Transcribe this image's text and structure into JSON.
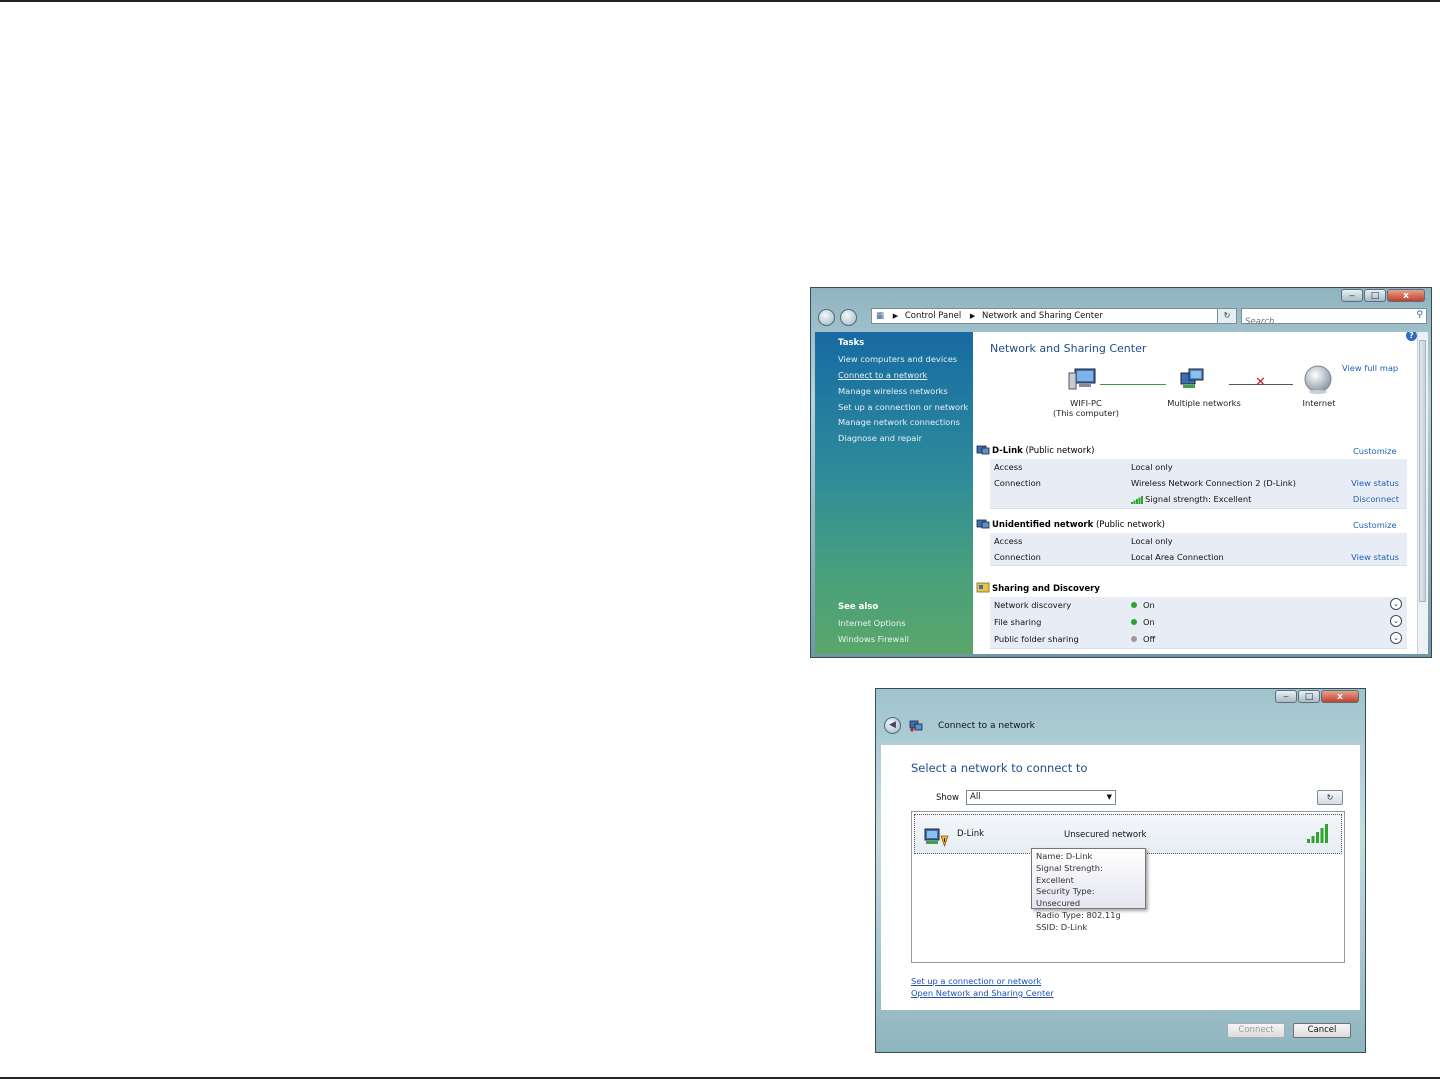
{
  "colors": {
    "link": "#1e5fb8",
    "title": "#1f4d8c",
    "status_on": "#2ea52e",
    "status_off": "#9a9a9a",
    "error_x": "#d42020",
    "signal": "#2ea52e"
  },
  "network_center": {
    "window_buttons": {
      "minimize": "‒",
      "maximize": "□",
      "close": "x"
    },
    "address": {
      "segments": [
        "Control Panel",
        "Network and Sharing Center"
      ]
    },
    "search": {
      "placeholder": "Search"
    },
    "sidebar": {
      "tasks_heading": "Tasks",
      "tasks": [
        "View computers and devices",
        "Connect to a network",
        "Manage wireless networks",
        "Set up a connection or network",
        "Manage network connections",
        "Diagnose and repair"
      ],
      "see_also_heading": "See also",
      "see_also": [
        "Internet Options",
        "Windows Firewall"
      ]
    },
    "title": "Network and Sharing Center",
    "view_full_map": "View full map",
    "map": {
      "computer_name": "WIFI-PC",
      "computer_sub": "(This computer)",
      "middle": "Multiple networks",
      "internet": "Internet",
      "icons": [
        "computer-icon",
        "network-icon",
        "globe-icon"
      ]
    },
    "networks": [
      {
        "name": "D-Link",
        "type": "(Public network)",
        "customize": "Customize",
        "rows": [
          {
            "key": "Access",
            "value": "Local only",
            "action": ""
          },
          {
            "key": "Connection",
            "value": "Wireless Network Connection 2 (D-Link)",
            "action": "View status"
          },
          {
            "key": "",
            "value": "Signal strength:  Excellent",
            "action": "Disconnect"
          }
        ]
      },
      {
        "name": "Unidentified network",
        "type": "(Public network)",
        "customize": "Customize",
        "rows": [
          {
            "key": "Access",
            "value": "Local only",
            "action": ""
          },
          {
            "key": "Connection",
            "value": "Local Area Connection",
            "action": "View status"
          }
        ]
      }
    ],
    "sharing": {
      "heading": "Sharing and Discovery",
      "rows": [
        {
          "key": "Network discovery",
          "value": "On"
        },
        {
          "key": "File sharing",
          "value": "On"
        },
        {
          "key": "Public folder sharing",
          "value": "Off"
        }
      ]
    }
  },
  "connect_dialog": {
    "window_buttons": {
      "minimize": "‒",
      "maximize": "□",
      "close": "x"
    },
    "title": "Connect to a network",
    "heading": "Select a network to connect to",
    "show_label": "Show",
    "show_value": "All",
    "refresh_icon": "refresh-icon",
    "network": {
      "name": "D-Link",
      "security": "Unsecured network",
      "signal_bars": 5
    },
    "tooltip": [
      "Name: D-Link",
      "Signal Strength: Excellent",
      "Security Type: Unsecured",
      "Radio Type: 802.11g",
      "SSID: D-Link"
    ],
    "links": [
      "Set up a connection or network",
      "Open Network and Sharing Center"
    ],
    "buttons": {
      "connect": "Connect",
      "cancel": "Cancel"
    }
  }
}
